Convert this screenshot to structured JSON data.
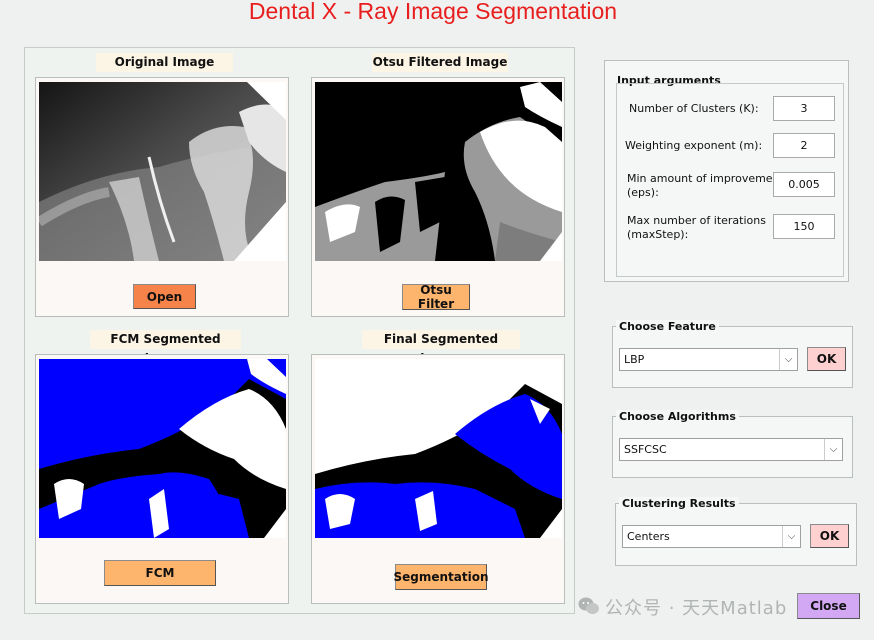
{
  "window": {
    "title": "Dental X - Ray Image Segmentation"
  },
  "panels": {
    "original": {
      "label": "Original Image",
      "button": "Open"
    },
    "otsu": {
      "label": "Otsu Filtered Image",
      "button": "Otsu Filter"
    },
    "fcm": {
      "label": "FCM Segmented Image",
      "button": "FCM"
    },
    "final": {
      "label": "Final Segmented Image",
      "button": "Segmentation"
    }
  },
  "input_args": {
    "title": "Input arguments",
    "params": [
      {
        "label": "Number of Clusters (K):",
        "value": "3"
      },
      {
        "label": "Weighting exponent (m):",
        "value": "2"
      },
      {
        "label_line1": "Min amount of improvement",
        "label_line2": "(eps):",
        "value": "0.005"
      },
      {
        "label_line1": "Max number of iterations",
        "label_line2": "(maxStep):",
        "value": "150"
      }
    ]
  },
  "choose_feature": {
    "title": "Choose Feature",
    "selected": "LBP",
    "button": "OK"
  },
  "choose_algorithms": {
    "title": "Choose Algorithms",
    "selected": "SSFCSC"
  },
  "clustering_results": {
    "title": "Clustering Results",
    "selected": "Centers",
    "button": "OK"
  },
  "close_button": "Close",
  "watermark": "公众号 · 天天Matlab",
  "colors": {
    "title": "#e81e1e",
    "open_button": "#f6834a",
    "action_button": "#fdb46c",
    "ok_button": "#ffd0d0",
    "close_button": "#d2a8f5",
    "segment_blue": "#0000ff"
  },
  "icons": {
    "dropdown": "chevron-down-icon",
    "watermark_logo": "wechat-icon"
  }
}
